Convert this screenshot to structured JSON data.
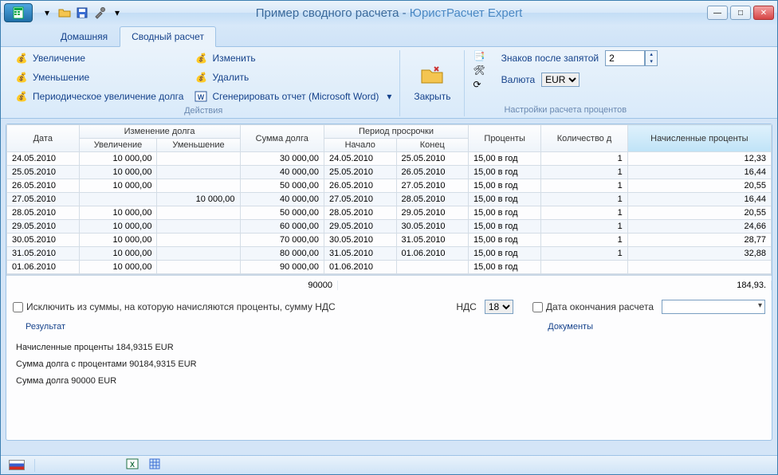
{
  "title": {
    "prefix": "Пример сводного расчета - ",
    "suffix": "ЮристРасчет Expert"
  },
  "tabs": {
    "home": "Домашняя",
    "summary": "Сводный расчет"
  },
  "ribbon": {
    "actions_label": "Действия",
    "settings_label": "Настройки расчета процентов",
    "increase": "Увеличение",
    "decrease": "Уменьшение",
    "periodic_increase": "Периодическое увеличение долга",
    "edit": "Изменить",
    "delete": "Удалить",
    "gen_report": "Сгенерировать отчет (Microsoft Word)",
    "close": "Закрыть",
    "decimals_label": "Знаков после запятой",
    "decimals_value": "2",
    "currency_label": "Валюта",
    "currency_value": "EUR"
  },
  "grid": {
    "headers": {
      "date": "Дата",
      "debt_change": "Изменение долга",
      "increase": "Увеличение",
      "decrease": "Уменьшение",
      "debt_sum": "Сумма долга",
      "overdue_period": "Период просрочки",
      "start": "Начало",
      "end": "Конец",
      "percent": "Проценты",
      "qty": "Количество д",
      "accrued": "Начисленные проценты"
    },
    "rows": [
      {
        "date": "24.05.2010",
        "inc": "10 000,00",
        "dec": "",
        "sum": "30 000,00",
        "start": "24.05.2010",
        "end": "25.05.2010",
        "pct": "15,00 в год",
        "qty": "1",
        "accr": "12,33"
      },
      {
        "date": "25.05.2010",
        "inc": "10 000,00",
        "dec": "",
        "sum": "40 000,00",
        "start": "25.05.2010",
        "end": "26.05.2010",
        "pct": "15,00 в год",
        "qty": "1",
        "accr": "16,44"
      },
      {
        "date": "26.05.2010",
        "inc": "10 000,00",
        "dec": "",
        "sum": "50 000,00",
        "start": "26.05.2010",
        "end": "27.05.2010",
        "pct": "15,00 в год",
        "qty": "1",
        "accr": "20,55",
        "dashed": true
      },
      {
        "date": "27.05.2010",
        "inc": "",
        "dec": "10 000,00",
        "sum": "40 000,00",
        "start": "27.05.2010",
        "end": "28.05.2010",
        "pct": "15,00 в год",
        "qty": "1",
        "accr": "16,44"
      },
      {
        "date": "28.05.2010",
        "inc": "10 000,00",
        "dec": "",
        "sum": "50 000,00",
        "start": "28.05.2010",
        "end": "29.05.2010",
        "pct": "15,00 в год",
        "qty": "1",
        "accr": "20,55"
      },
      {
        "date": "29.05.2010",
        "inc": "10 000,00",
        "dec": "",
        "sum": "60 000,00",
        "start": "29.05.2010",
        "end": "30.05.2010",
        "pct": "15,00 в год",
        "qty": "1",
        "accr": "24,66"
      },
      {
        "date": "30.05.2010",
        "inc": "10 000,00",
        "dec": "",
        "sum": "70 000,00",
        "start": "30.05.2010",
        "end": "31.05.2010",
        "pct": "15,00 в год",
        "qty": "1",
        "accr": "28,77"
      },
      {
        "date": "31.05.2010",
        "inc": "10 000,00",
        "dec": "",
        "sum": "80 000,00",
        "start": "31.05.2010",
        "end": "01.06.2010",
        "pct": "15,00 в год",
        "qty": "1",
        "accr": "32,88"
      },
      {
        "date": "01.06.2010",
        "inc": "10 000,00",
        "dec": "",
        "sum": "90 000,00",
        "start": "01.06.2010",
        "end": "",
        "pct": "15,00 в год",
        "qty": "",
        "accr": ""
      }
    ],
    "totals": {
      "sum": "90000",
      "accr": "184,93."
    }
  },
  "options": {
    "exclude_vat": "Исключить из суммы, на которую начисляются проценты, сумму НДС",
    "vat_label": "НДС",
    "vat_value": "18",
    "end_date_label": "Дата окончания расчета",
    "result_label": "Результат",
    "docs_label": "Документы"
  },
  "results": {
    "line1": "Начисленные проценты 184,9315 EUR",
    "line2": "Сумма долга с процентами 90184,9315 EUR",
    "line3": "Сумма долга 90000 EUR"
  }
}
